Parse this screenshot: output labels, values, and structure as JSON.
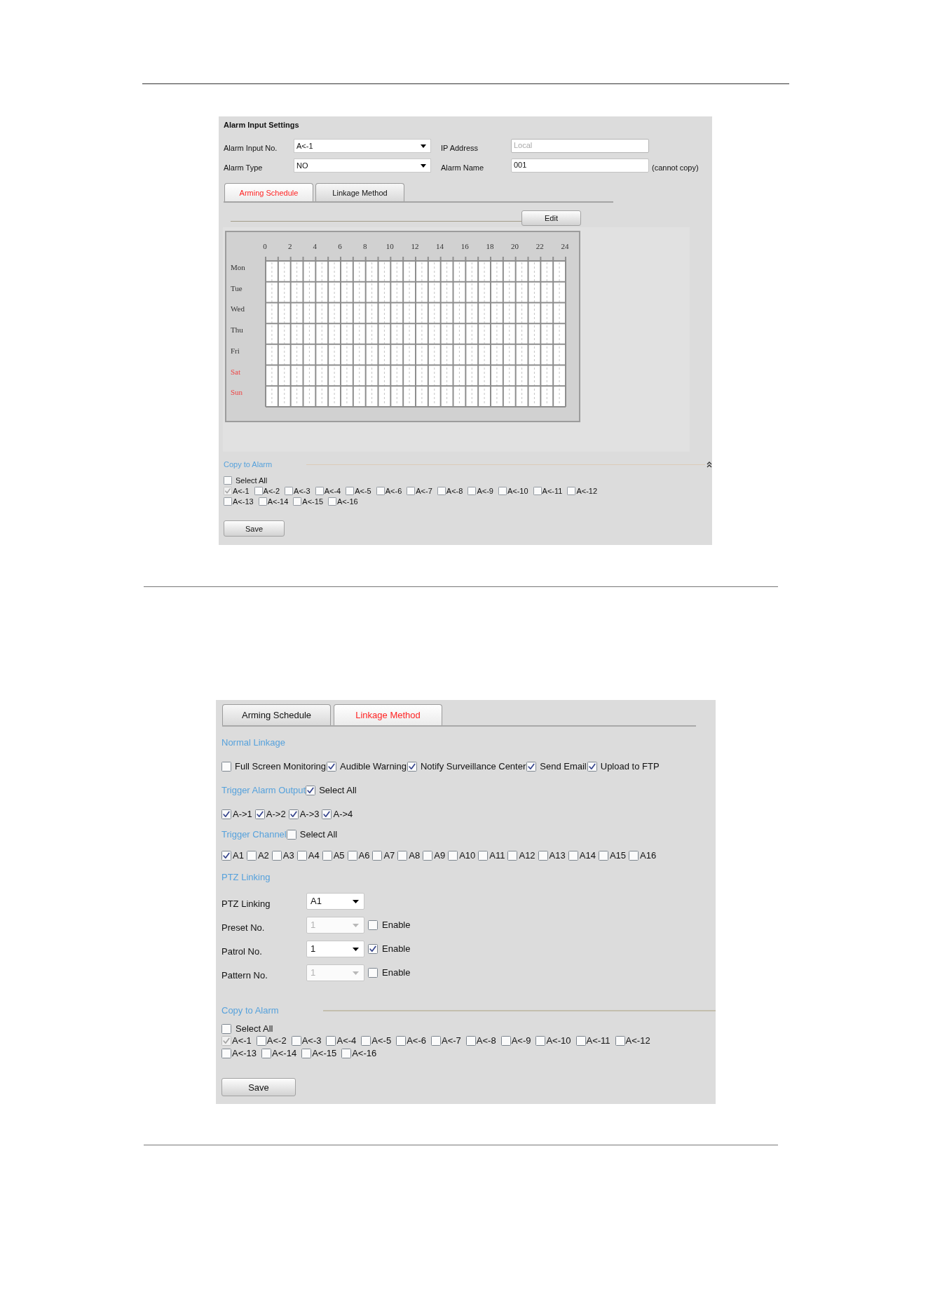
{
  "schedule_screenshot": {
    "title": "Alarm Input Settings",
    "fields": [
      {
        "label": "Alarm Input No.",
        "kind": "select",
        "value": "A<-1",
        "disabled": false
      },
      {
        "label": "IP Address",
        "kind": "text",
        "value": "Local",
        "disabled": true
      },
      {
        "label": "Alarm Type",
        "kind": "select",
        "value": "NO",
        "disabled": false
      },
      {
        "label": "Alarm Name",
        "kind": "text",
        "value": "001",
        "disabled": false,
        "note": "(cannot copy)"
      }
    ],
    "tabs": [
      {
        "label": "Arming Schedule",
        "selected": true
      },
      {
        "label": "Linkage Method",
        "selected": false
      }
    ],
    "edit_button": "Edit",
    "schedule": {
      "hour_labels": [
        "0",
        "2",
        "4",
        "6",
        "8",
        "10",
        "12",
        "14",
        "16",
        "18",
        "20",
        "22",
        "24"
      ],
      "days": [
        {
          "label": "Mon",
          "weekend": false
        },
        {
          "label": "Tue",
          "weekend": false
        },
        {
          "label": "Wed",
          "weekend": false
        },
        {
          "label": "Thu",
          "weekend": false
        },
        {
          "label": "Fri",
          "weekend": false
        },
        {
          "label": "Sat",
          "weekend": true
        },
        {
          "label": "Sun",
          "weekend": true
        }
      ]
    },
    "copy_to_alarm": {
      "title": "Copy to Alarm",
      "select_all": {
        "label": "Select All",
        "checked": false
      },
      "alarm_rows": [
        [
          {
            "label": "A<-1",
            "checked": true,
            "disabled": true
          },
          {
            "label": "A<-2",
            "checked": false,
            "disabled": false
          },
          {
            "label": "A<-3",
            "checked": false,
            "disabled": false
          },
          {
            "label": "A<-4",
            "checked": false,
            "disabled": false
          },
          {
            "label": "A<-5",
            "checked": false,
            "disabled": false
          },
          {
            "label": "A<-6",
            "checked": false,
            "disabled": false
          },
          {
            "label": "A<-7",
            "checked": false,
            "disabled": false
          },
          {
            "label": "A<-8",
            "checked": false,
            "disabled": false
          },
          {
            "label": "A<-9",
            "checked": false,
            "disabled": false
          },
          {
            "label": "A<-10",
            "checked": false,
            "disabled": false
          },
          {
            "label": "A<-11",
            "checked": false,
            "disabled": false
          },
          {
            "label": "A<-12",
            "checked": false,
            "disabled": false
          }
        ],
        [
          {
            "label": "A<-13",
            "checked": false,
            "disabled": false
          },
          {
            "label": "A<-14",
            "checked": false,
            "disabled": false
          },
          {
            "label": "A<-15",
            "checked": false,
            "disabled": false
          },
          {
            "label": "A<-16",
            "checked": false,
            "disabled": false
          }
        ]
      ]
    },
    "save_button": "Save"
  },
  "linkage_screenshot": {
    "tabs": [
      {
        "label": "Arming Schedule",
        "selected": false
      },
      {
        "label": "Linkage Method",
        "selected": true
      }
    ],
    "normal_linkage": {
      "title": "Normal Linkage",
      "options": [
        {
          "label": "Full Screen Monitoring",
          "checked": false
        },
        {
          "label": "Audible Warning",
          "checked": true
        },
        {
          "label": "Notify Surveillance Center",
          "checked": true
        },
        {
          "label": "Send Email",
          "checked": true
        },
        {
          "label": "Upload to FTP",
          "checked": true
        }
      ]
    },
    "trigger_alarm_output": {
      "title": "Trigger Alarm Output",
      "select_all": {
        "label": "Select All",
        "checked": true
      },
      "outputs": [
        {
          "label": "A->1",
          "checked": true
        },
        {
          "label": "A->2",
          "checked": true
        },
        {
          "label": "A->3",
          "checked": true
        },
        {
          "label": "A->4",
          "checked": true
        }
      ]
    },
    "trigger_channel": {
      "title": "Trigger Channel",
      "select_all": {
        "label": "Select All",
        "checked": false
      },
      "channels": [
        {
          "label": "A1",
          "checked": true
        },
        {
          "label": "A2",
          "checked": false
        },
        {
          "label": "A3",
          "checked": false
        },
        {
          "label": "A4",
          "checked": false
        },
        {
          "label": "A5",
          "checked": false
        },
        {
          "label": "A6",
          "checked": false
        },
        {
          "label": "A7",
          "checked": false
        },
        {
          "label": "A8",
          "checked": false
        },
        {
          "label": "A9",
          "checked": false
        },
        {
          "label": "A10",
          "checked": false
        },
        {
          "label": "A11",
          "checked": false
        },
        {
          "label": "A12",
          "checked": false
        },
        {
          "label": "A13",
          "checked": false
        },
        {
          "label": "A14",
          "checked": false
        },
        {
          "label": "A15",
          "checked": false
        },
        {
          "label": "A16",
          "checked": false
        }
      ]
    },
    "ptz_linking": {
      "title": "PTZ Linking",
      "rows": [
        {
          "label": "PTZ Linking",
          "value": "A1",
          "disabled": false
        },
        {
          "label": "Preset No.",
          "value": "1",
          "disabled": true,
          "enable": {
            "label": "Enable",
            "checked": false
          }
        },
        {
          "label": "Patrol No.",
          "value": "1",
          "disabled": false,
          "enable": {
            "label": "Enable",
            "checked": true
          }
        },
        {
          "label": "Pattern No.",
          "value": "1",
          "disabled": true,
          "enable": {
            "label": "Enable",
            "checked": false
          }
        }
      ]
    },
    "copy_to_alarm": {
      "title": "Copy to Alarm",
      "select_all": {
        "label": "Select All",
        "checked": false
      },
      "alarm_rows": [
        [
          {
            "label": "A<-1",
            "checked": true,
            "disabled": true
          },
          {
            "label": "A<-2",
            "checked": false,
            "disabled": false
          },
          {
            "label": "A<-3",
            "checked": false,
            "disabled": false
          },
          {
            "label": "A<-4",
            "checked": false,
            "disabled": false
          },
          {
            "label": "A<-5",
            "checked": false,
            "disabled": false
          },
          {
            "label": "A<-6",
            "checked": false,
            "disabled": false
          },
          {
            "label": "A<-7",
            "checked": false,
            "disabled": false
          },
          {
            "label": "A<-8",
            "checked": false,
            "disabled": false
          },
          {
            "label": "A<-9",
            "checked": false,
            "disabled": false
          },
          {
            "label": "A<-10",
            "checked": false,
            "disabled": false
          },
          {
            "label": "A<-11",
            "checked": false,
            "disabled": false
          },
          {
            "label": "A<-12",
            "checked": false,
            "disabled": false
          }
        ],
        [
          {
            "label": "A<-13",
            "checked": false,
            "disabled": false
          },
          {
            "label": "A<-14",
            "checked": false,
            "disabled": false
          },
          {
            "label": "A<-15",
            "checked": false,
            "disabled": false
          },
          {
            "label": "A<-16",
            "checked": false,
            "disabled": false
          }
        ]
      ]
    },
    "save_button": "Save"
  }
}
